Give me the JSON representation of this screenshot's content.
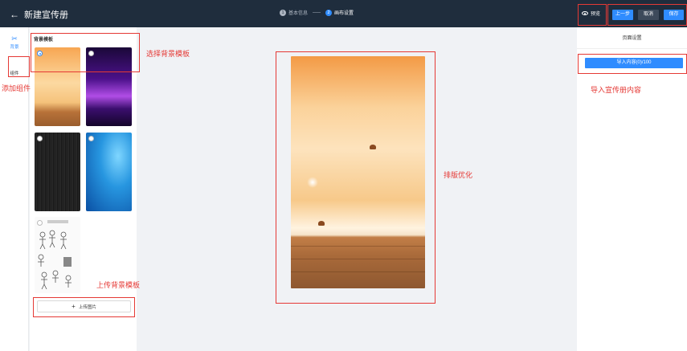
{
  "header": {
    "back_label": "新建宣传册",
    "steps": [
      {
        "num": "1",
        "label": "基本信息"
      },
      {
        "num": "2",
        "label": "画布设置"
      }
    ],
    "preview_label": "预览",
    "prev_label": "上一步",
    "cancel_label": "取消",
    "save_label": "保存"
  },
  "rail": {
    "background_label": "背景",
    "component_label": "组件"
  },
  "panel": {
    "title": "背景模板",
    "upload_label": "上传图片"
  },
  "right_panel": {
    "title": "页面设置",
    "import_label": "导入内容(0)/100"
  },
  "annotations": {
    "select_bg": "选择背景模板",
    "add_component": "添加组件",
    "upload_bg": "上传背景模板",
    "layout_optimize": "排版优化",
    "import_content": "导入宣传册内容"
  },
  "colors": {
    "topbar": "#1f2d3d",
    "accent": "#2f8cff",
    "annotation": "#e53935"
  }
}
